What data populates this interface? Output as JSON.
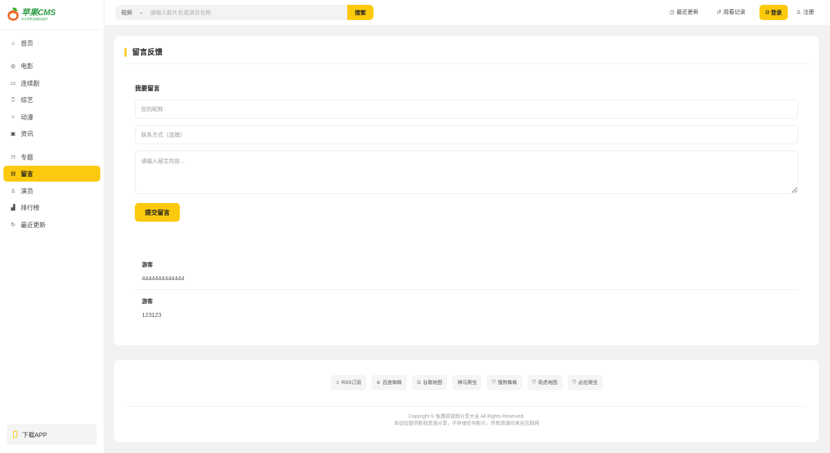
{
  "logo": {
    "title": "苹果CMS",
    "subtitle": "永久免费全能建站程序"
  },
  "sidebar": {
    "items": [
      {
        "label": "首页",
        "icon": "home-icon",
        "glyph": "⌂"
      },
      {
        "label": "电影",
        "icon": "film-icon",
        "glyph": "◎"
      },
      {
        "label": "连续剧",
        "icon": "tv-icon",
        "glyph": "▭"
      },
      {
        "label": "综艺",
        "icon": "variety-icon",
        "glyph": "♖"
      },
      {
        "label": "动漫",
        "icon": "anime-icon",
        "glyph": "⑂"
      },
      {
        "label": "资讯",
        "icon": "news-icon",
        "glyph": "▣"
      },
      {
        "label": "专题",
        "icon": "bookmark-icon",
        "glyph": "⊓"
      },
      {
        "label": "留言",
        "icon": "message-icon",
        "glyph": "⊟"
      },
      {
        "label": "演员",
        "icon": "actor-icon",
        "glyph": "♙"
      },
      {
        "label": "排行榜",
        "icon": "ranking-icon",
        "glyph": "▟"
      },
      {
        "label": "最近更新",
        "icon": "refresh-icon",
        "glyph": "↻"
      }
    ],
    "active": "留言",
    "download_app": "下载APP"
  },
  "header": {
    "search": {
      "category": "视频",
      "placeholder": "请输入影片名或演员名称",
      "button": "搜索"
    },
    "recent_updates": "最近更新",
    "watch_history": "观看记录",
    "login": "登录",
    "register": "注册"
  },
  "guestbook": {
    "title": "留言反馈",
    "form_label": "我要留言",
    "nickname_placeholder": "您的昵称",
    "contact_placeholder": "联系方式（选填）",
    "content_placeholder": "请输入留言内容...",
    "submit": "提交留言",
    "messages": [
      {
        "author": "游客",
        "content": "4444444444444"
      },
      {
        "author": "游客",
        "content": "123123"
      }
    ]
  },
  "footer": {
    "links": [
      {
        "label": "RSS订阅",
        "icon": "rss-icon",
        "glyph": "⊃"
      },
      {
        "label": "百度蜘蛛",
        "icon": "baidu-icon",
        "glyph": "⊜"
      },
      {
        "label": "谷歌地图",
        "icon": "google-icon",
        "glyph": "G"
      },
      {
        "label": "神马爬虫",
        "icon": "",
        "glyph": ""
      },
      {
        "label": "搜狗蜘蛛",
        "icon": "sogou-icon",
        "glyph": "⛉"
      },
      {
        "label": "奇虎地图",
        "icon": "qihoo-icon",
        "glyph": "⛉"
      },
      {
        "label": "必应爬虫",
        "icon": "bing-icon",
        "glyph": "⛉"
      }
    ],
    "copyright_line1": "Copyright © 免费短视频分享大全 All Rights Reserved.",
    "copyright_line2": "本站仅提供影视资源分享，不存储任何影片，所有资源均来自互联网"
  },
  "colors": {
    "accent": "#fcc90c",
    "logo_green": "#2e9e46",
    "logo_orange": "#ef6b25"
  }
}
